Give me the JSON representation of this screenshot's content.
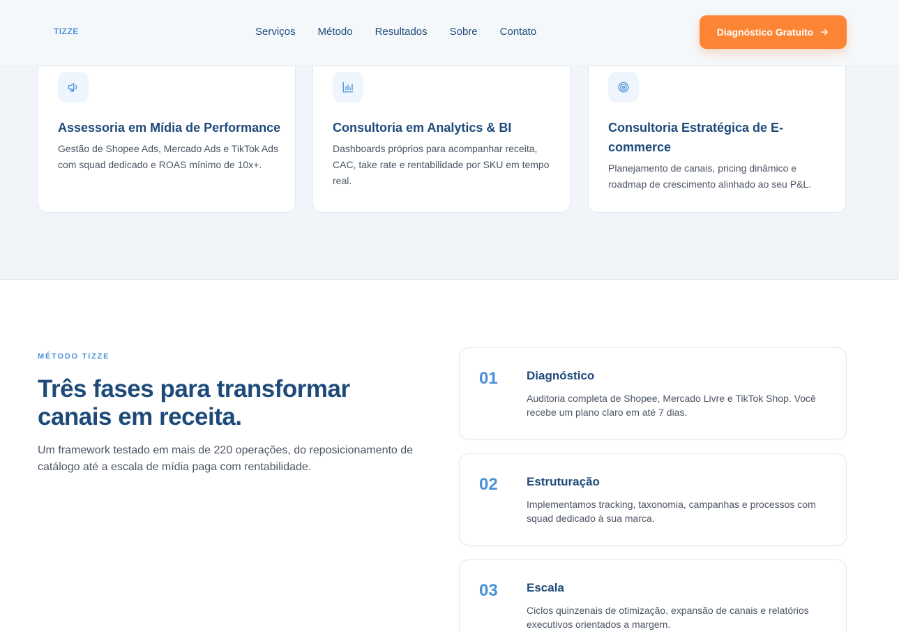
{
  "header": {
    "logo": "TIZZE",
    "nav": [
      "Serviços",
      "Método",
      "Resultados",
      "Sobre",
      "Contato"
    ],
    "cta_label": "Diagnóstico Gratuito"
  },
  "services": [
    {
      "icon": "megaphone-icon",
      "title": "Assessoria em Mídia de Performance",
      "description": "Gestão de Shopee Ads, Mercado Ads e TikTok Ads com squad dedicado e ROAS mínimo de 10x+."
    },
    {
      "icon": "bar-chart-icon",
      "title": "Consultoria em Analytics & BI",
      "description": "Dashboards próprios para acompanhar receita, CAC, take rate e rentabilidade por SKU em tempo real."
    },
    {
      "icon": "target-icon",
      "title": "Consultoria Estratégica de E-commerce",
      "description": "Planejamento de canais, pricing dinâmico e roadmap de crescimento alinhado ao seu P&L."
    }
  ],
  "method": {
    "eyebrow": "MÉTODO TIZZE",
    "title": "Três fases para transformar canais em receita.",
    "description": "Um framework testado em mais de 220 operações, do reposicionamento de catálogo até a escala de mídia paga com rentabilidade.",
    "steps": [
      {
        "number": "01",
        "title": "Diagnóstico",
        "description": "Auditoria completa de Shopee, Mercado Livre e TikTok Shop. Você recebe um plano claro em até 7 dias."
      },
      {
        "number": "02",
        "title": "Estruturação",
        "description": "Implementamos tracking, taxonomia, campanhas e processos com squad dedicado à sua marca."
      },
      {
        "number": "03",
        "title": "Escala",
        "description": "Ciclos quinzenais de otimização, expansão de canais e relatórios executivos orientados a margem."
      }
    ]
  },
  "colors": {
    "brand_blue": "#1e4a7a",
    "accent_blue": "#4a90d9",
    "cta_orange": "#fb8435",
    "band_bg": "#f1f5f9"
  }
}
